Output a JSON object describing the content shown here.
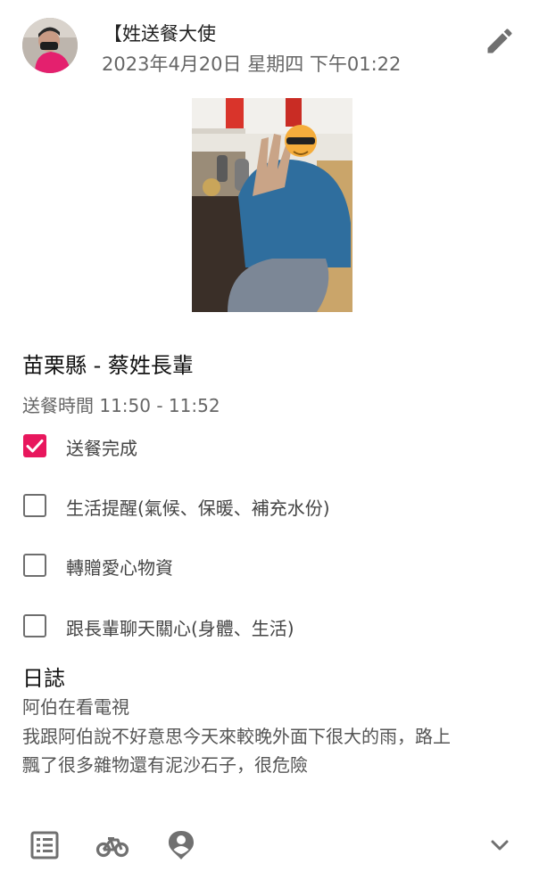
{
  "post": {
    "sender_name": "【姓送餐大使",
    "date": "2023年4月20日 星期四 下午01:22"
  },
  "icons": {
    "edit": "pencil-icon",
    "list": "list-icon",
    "bike": "bike-icon",
    "person": "person-pin-icon",
    "expand": "chevron-down-icon"
  },
  "recipient": {
    "title": "苗栗縣 - 蔡姓長輩",
    "time": "送餐時間 11:50 - 11:52"
  },
  "tasks": [
    {
      "label": "送餐完成",
      "checked": true
    },
    {
      "label": "生活提醒(氣候、保暖、補充水份)",
      "checked": false
    },
    {
      "label": "轉贈愛心物資",
      "checked": false
    },
    {
      "label": "跟長輩聊天關心(身體、生活)",
      "checked": false
    }
  ],
  "journal": {
    "heading": "日誌",
    "lines": [
      "阿伯在看電視",
      "我跟阿伯說不好意思今天來較晚外面下很大的雨，路上",
      "飄了很多雜物還有泥沙石子，很危險"
    ]
  },
  "colors": {
    "accent": "#e8175d",
    "text_secondary": "#666666",
    "icon": "#707070"
  }
}
